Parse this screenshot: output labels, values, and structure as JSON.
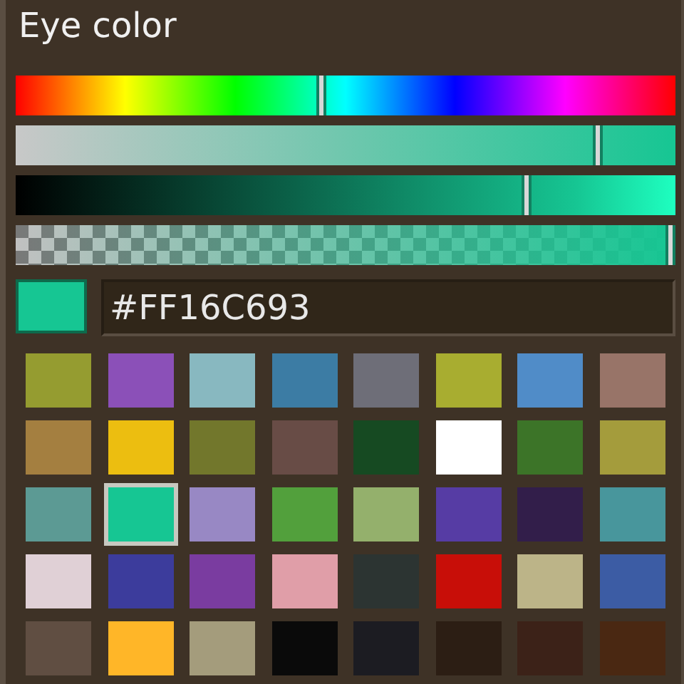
{
  "title": "Eye color",
  "sliders": [
    {
      "kind": "hue",
      "level": 0.46
    },
    {
      "kind": "saturation",
      "level": 0.88
    },
    {
      "kind": "value",
      "level": 0.77
    },
    {
      "kind": "alpha",
      "level": 0.99
    }
  ],
  "preview": {
    "color": "#16c693"
  },
  "hex_field": {
    "value": "#FF16C693"
  },
  "swatches": [
    {
      "color": "#959c30",
      "selected": false
    },
    {
      "color": "#8b50b8",
      "selected": false
    },
    {
      "color": "#88b8c0",
      "selected": false
    },
    {
      "color": "#3c7ca4",
      "selected": false
    },
    {
      "color": "#6e6e78",
      "selected": false
    },
    {
      "color": "#a8ad30",
      "selected": false
    },
    {
      "color": "#508cc8",
      "selected": false
    },
    {
      "color": "#987468",
      "selected": false
    },
    {
      "color": "#a47f40",
      "selected": false
    },
    {
      "color": "#ecbe10",
      "selected": false
    },
    {
      "color": "#72772c",
      "selected": false
    },
    {
      "color": "#684c46",
      "selected": false
    },
    {
      "color": "#164a22",
      "selected": false
    },
    {
      "color": "#ffffff",
      "selected": false
    },
    {
      "color": "#3c7428",
      "selected": false
    },
    {
      "color": "#a49c3c",
      "selected": false
    },
    {
      "color": "#5c9a94",
      "selected": false
    },
    {
      "color": "#16c693",
      "selected": true
    },
    {
      "color": "#9888c4",
      "selected": false
    },
    {
      "color": "#52a03c",
      "selected": false
    },
    {
      "color": "#94b06c",
      "selected": false
    },
    {
      "color": "#563ca4",
      "selected": false
    },
    {
      "color": "#321e4a",
      "selected": false
    },
    {
      "color": "#48969c",
      "selected": false
    },
    {
      "color": "#e0d0d6",
      "selected": false
    },
    {
      "color": "#3c3c9c",
      "selected": false
    },
    {
      "color": "#7a3ca0",
      "selected": false
    },
    {
      "color": "#e09ea8",
      "selected": false
    },
    {
      "color": "#2c3432",
      "selected": false
    },
    {
      "color": "#c80e08",
      "selected": false
    },
    {
      "color": "#bcb488",
      "selected": false
    },
    {
      "color": "#3c5ca4",
      "selected": false
    },
    {
      "color": "#604e42",
      "selected": false
    },
    {
      "color": "#ffb628",
      "selected": false
    },
    {
      "color": "#a49c7c",
      "selected": false
    },
    {
      "color": "#0a0a0a",
      "selected": false
    },
    {
      "color": "#1c1c22",
      "selected": false
    },
    {
      "color": "#2c1e14",
      "selected": false
    },
    {
      "color": "#3c2218",
      "selected": false
    },
    {
      "color": "#4a2812",
      "selected": false
    }
  ]
}
